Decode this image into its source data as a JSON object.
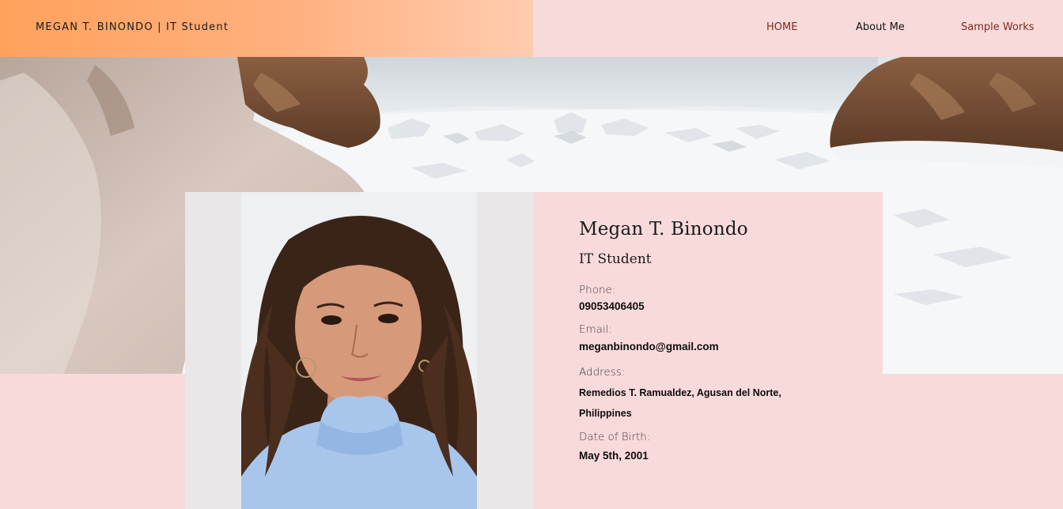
{
  "header": {
    "brand": "MEGAN T. BINONDO | IT Student",
    "nav": [
      "HOME",
      "About Me",
      "Sample Works"
    ]
  },
  "profile": {
    "name": "Megan T. Binondo",
    "role": "IT Student",
    "phone_label": "Phone:",
    "phone": "09053406405",
    "email_label": "Email:",
    "email": "meganbinondo@gmail.com",
    "address_label": "Address:",
    "address_line1": "Remedios T. Ramualdez, Agusan del Norte,",
    "address_line2": "Philippines",
    "dob_label": "Date of Birth:",
    "dob": "May 5th, 2001"
  },
  "colors": {
    "page_bg": "#f9dada",
    "brand_gradient_start": "#ffa25c",
    "brand_gradient_end": "#ffccaf",
    "nav_accent": "#7a2a1f"
  }
}
